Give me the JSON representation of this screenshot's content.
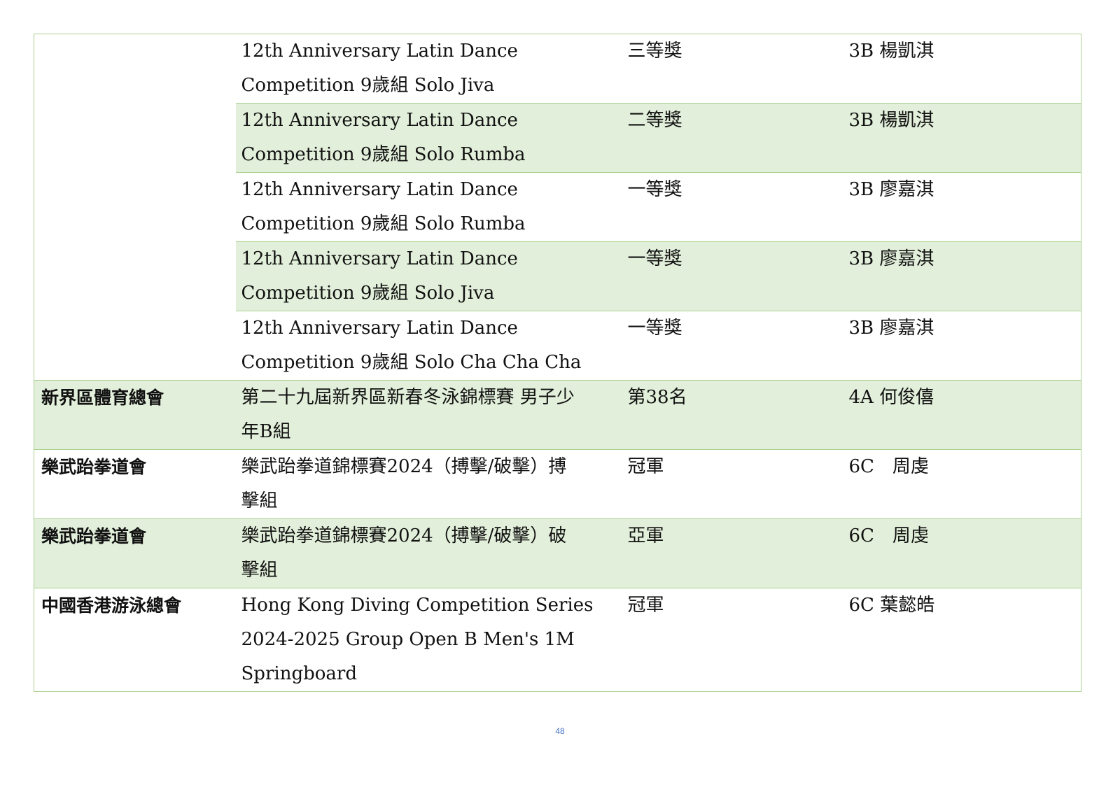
{
  "table": {
    "rows": [
      {
        "organization": "",
        "competition_lines": [
          "12th Anniversary Latin Dance",
          "Competition 9歲組 Solo Jiva"
        ],
        "award": "三等獎",
        "student": "3B 楊凱淇",
        "shaded": false
      },
      {
        "organization": "",
        "competition_lines": [
          "12th Anniversary Latin Dance",
          "Competition 9歲組 Solo Rumba"
        ],
        "award": "二等獎",
        "student": "3B 楊凱淇",
        "shaded": true
      },
      {
        "organization": "",
        "competition_lines": [
          "12th Anniversary Latin Dance",
          "Competition 9歲組 Solo Rumba"
        ],
        "award": "一等獎",
        "student": "3B 廖嘉淇",
        "shaded": false
      },
      {
        "organization": "",
        "competition_lines": [
          "12th Anniversary Latin Dance",
          "Competition 9歲組 Solo Jiva"
        ],
        "award": "一等獎",
        "student": "3B 廖嘉淇",
        "shaded": true
      },
      {
        "organization": "",
        "competition_lines": [
          "12th Anniversary Latin Dance",
          "Competition 9歲組 Solo Cha Cha Cha"
        ],
        "award": "一等獎",
        "student": "3B 廖嘉淇",
        "shaded": false
      },
      {
        "organization": "新界區體育總會",
        "competition_lines": [
          "第二十九屆新界區新春冬泳錦標賽 男子少",
          "年B組"
        ],
        "award": "第38名",
        "student": "4A 何俊僖",
        "shaded": true
      },
      {
        "organization": "樂武跆拳道會",
        "competition_lines": [
          "樂武跆拳道錦標賽2024（搏擊/破擊）搏",
          "擊組"
        ],
        "award": "冠軍",
        "student": "6C　周虔",
        "shaded": false
      },
      {
        "organization": "樂武跆拳道會",
        "competition_lines": [
          "樂武跆拳道錦標賽2024（搏擊/破擊）破",
          "擊組"
        ],
        "award": "亞軍",
        "student": "6C　周虔",
        "shaded": true
      },
      {
        "organization": "中國香港游泳總會",
        "competition_lines": [
          "Hong Kong Diving Competition Series",
          "2024-2025 Group Open B Men's 1M",
          "Springboard"
        ],
        "award": "冠軍",
        "student": "6C 葉懿皓",
        "shaded": false
      }
    ]
  },
  "footer": {
    "page_number": "48"
  },
  "colors": {
    "border": "#a9d08e",
    "row_shade": "#e2efda",
    "page_number": "#4472c4"
  }
}
